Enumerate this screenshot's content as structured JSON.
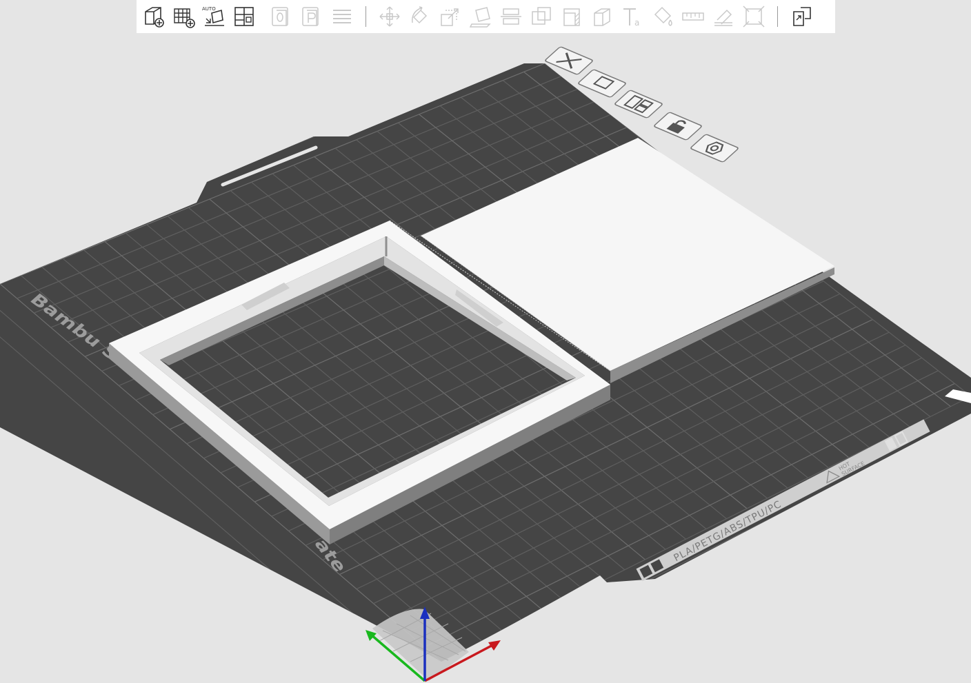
{
  "toolbar": {
    "groups": [
      [
        {
          "name": "add-icon",
          "enabled": true
        },
        {
          "name": "add-plate-icon",
          "enabled": true
        },
        {
          "name": "auto-orient-icon",
          "enabled": true,
          "label": "AUTO"
        },
        {
          "name": "arrange-icon",
          "enabled": true
        }
      ],
      [
        {
          "name": "split-objects-icon",
          "enabled": false
        },
        {
          "name": "split-parts-icon",
          "enabled": false
        },
        {
          "name": "layers-icon",
          "enabled": false
        }
      ],
      [
        {
          "name": "move-icon",
          "enabled": false
        },
        {
          "name": "rotate-icon",
          "enabled": false
        },
        {
          "name": "scale-icon",
          "enabled": false
        },
        {
          "name": "lay-on-face-icon",
          "enabled": false
        },
        {
          "name": "cut-icon",
          "enabled": false
        },
        {
          "name": "boolean-icon",
          "enabled": false
        },
        {
          "name": "support-paint-icon",
          "enabled": false
        },
        {
          "name": "seam-paint-icon",
          "enabled": false
        },
        {
          "name": "text-icon",
          "enabled": false,
          "label": "Ta"
        },
        {
          "name": "color-paint-icon",
          "enabled": false
        },
        {
          "name": "measure-icon",
          "enabled": false
        },
        {
          "name": "assembly-icon",
          "enabled": false
        },
        {
          "name": "simplify-icon",
          "enabled": false
        }
      ],
      [
        {
          "name": "assembly-view-icon",
          "enabled": true
        }
      ]
    ]
  },
  "plate": {
    "side_label": "Bambu Smooth PEI Plate",
    "side_label_top": "Bambu Sm",
    "side_label_bottom": "ate",
    "materials": "PLA/PETG/ABS/TPU/PC",
    "hot_surface_line1": "HOT",
    "hot_surface_line2": "SURFACE"
  },
  "plate_buttons": [
    {
      "name": "delete-plate-icon"
    },
    {
      "name": "plate-settings-icon"
    },
    {
      "name": "arrange-plate-icon"
    },
    {
      "name": "lock-plate-icon"
    },
    {
      "name": "plate-gear-icon"
    }
  ],
  "colors": {
    "background": "#e5e5e5",
    "plate": "#454545",
    "grid": "#5e5e5e",
    "model_top": "#f6f6f6",
    "model_side": "#858585",
    "axis_x": "#c8191e",
    "axis_y": "#19b81e",
    "axis_z": "#1a2fbf"
  }
}
